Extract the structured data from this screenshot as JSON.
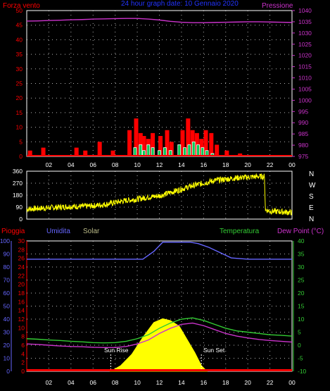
{
  "colors": {
    "background": "#000000",
    "frame": "#ffffff",
    "grid": "#ffffff",
    "wind": "#ff0000",
    "gust": "#ffffff",
    "wind_fill": "#00cc55",
    "pressure": "#cc33cc",
    "direction": "#ffff00",
    "rain": "#ff0000",
    "humidity": "#6666ff",
    "solar": "#ffff00",
    "temperature": "#33cc33",
    "dewpoint": "#cc33cc",
    "title": "#2233ff"
  },
  "header": {
    "left_label": "Forza vento",
    "title": "24 hour graph date: 10 Gennaio 2020",
    "right_label": "Pressione"
  },
  "direction_labels": [
    "N",
    "W",
    "S",
    "E",
    "N"
  ],
  "bottom_labels": {
    "rain": "Pioggia",
    "humidity": "Umidita",
    "solar": "Solar",
    "temperature": "Temperatura",
    "dewpoint": "Dew Point (°C)",
    "sunrise": "Sun Rise",
    "sunset": "Sun Set"
  },
  "chart_data": [
    {
      "type": "bar",
      "name": "wind",
      "ylim": [
        0,
        50
      ],
      "yticks": [
        0,
        5,
        10,
        15,
        20,
        25,
        30,
        35,
        40,
        45,
        50
      ],
      "y2lim": [
        975,
        1040
      ],
      "y2ticks": [
        975,
        980,
        985,
        990,
        995,
        1000,
        1005,
        1010,
        1015,
        1020,
        1025,
        1030,
        1035,
        1040
      ],
      "xlim": [
        0,
        24
      ],
      "xticks": [
        "02",
        "04",
        "06",
        "08",
        "10",
        "12",
        "14",
        "16",
        "18",
        "20",
        "22",
        "00"
      ],
      "series": [
        {
          "role": "wind_gust",
          "x": [
            0.3,
            1.5,
            4.5,
            5.3,
            6.6,
            7.8,
            9.3,
            9.9,
            10.3,
            10.6,
            11.0,
            11.4,
            12.1,
            12.7,
            13.1,
            14.1,
            14.6,
            15.0,
            15.4,
            15.8,
            16.2,
            16.7,
            17.2,
            18.1,
            19.3
          ],
          "values": [
            2,
            3,
            3,
            2,
            5,
            2,
            9,
            13,
            8,
            7,
            6,
            8,
            7,
            9,
            5,
            9,
            13,
            9,
            8,
            6,
            9,
            8,
            4,
            2,
            1
          ]
        },
        {
          "role": "wind_avg",
          "x": [
            9.8,
            10.3,
            10.6,
            11.0,
            11.4,
            12.0,
            12.5,
            13.0,
            13.8,
            14.3,
            14.7,
            15.1,
            15.5,
            15.9,
            16.3,
            16.8
          ],
          "values": [
            3,
            4,
            2,
            4,
            3,
            2,
            3,
            2,
            4,
            3,
            4,
            5,
            4,
            3,
            2,
            1
          ]
        },
        {
          "role": "pressure",
          "x": [
            0,
            1,
            2,
            3,
            4,
            5,
            6,
            7,
            8,
            9,
            10,
            11,
            12,
            13,
            14,
            15,
            16,
            17,
            18,
            19,
            20,
            21,
            22,
            23,
            24
          ],
          "values": [
            1035.3,
            1035.4,
            1035.6,
            1035.7,
            1035.9,
            1036.0,
            1036.2,
            1036.3,
            1036.4,
            1036.5,
            1036.5,
            1036.2,
            1035.8,
            1035.2,
            1034.8,
            1034.6,
            1034.6,
            1034.7,
            1034.8,
            1034.9,
            1035.0,
            1035.0,
            1034.9,
            1034.8,
            1034.7
          ]
        }
      ]
    },
    {
      "type": "line",
      "name": "wind_direction",
      "ylim": [
        0,
        360
      ],
      "yticks": [
        0,
        90,
        180,
        270,
        360
      ],
      "xlim": [
        0,
        24
      ],
      "series": [
        {
          "role": "direction",
          "x": [
            0,
            1,
            2,
            3,
            4,
            5,
            6,
            7,
            8,
            9,
            10,
            11,
            12,
            13,
            14,
            15,
            16,
            17,
            18,
            19,
            20,
            21,
            21.5,
            21.6,
            22,
            23,
            24
          ],
          "values": [
            75,
            80,
            85,
            90,
            95,
            95,
            100,
            110,
            125,
            140,
            150,
            165,
            175,
            200,
            225,
            250,
            270,
            290,
            300,
            310,
            315,
            320,
            320,
            70,
            60,
            55,
            50
          ]
        }
      ]
    },
    {
      "type": "line",
      "name": "atmospheric",
      "ylim": [
        -10,
        40
      ],
      "yticks": [
        -10,
        -5,
        0,
        5,
        10,
        15,
        20,
        25,
        30,
        35,
        40
      ],
      "y_humidity_lim": [
        0,
        100
      ],
      "y_humidity_ticks": [
        0,
        10,
        20,
        30,
        40,
        50,
        60,
        70,
        80,
        90,
        100
      ],
      "y_rain_lim": [
        0,
        30
      ],
      "y_rain_ticks": [
        0,
        2,
        4,
        6,
        8,
        10,
        12,
        14,
        16,
        18,
        20,
        22,
        24,
        26,
        28,
        30
      ],
      "xlim": [
        0,
        24
      ],
      "xticks": [
        "02",
        "04",
        "06",
        "08",
        "10",
        "12",
        "14",
        "16",
        "18",
        "20",
        "22",
        "00"
      ],
      "sunrise_x": 7.6,
      "sunset_x": 15.8,
      "series": [
        {
          "role": "humidity",
          "x": [
            0,
            2,
            4,
            6,
            8,
            9,
            10.5,
            11.5,
            12.3,
            13,
            14,
            14.8,
            15.5,
            16.5,
            17.5,
            18.5,
            20,
            22,
            24
          ],
          "values": [
            86,
            86,
            86,
            86,
            86,
            86,
            86,
            92,
            99,
            99,
            99,
            99,
            98,
            95,
            91,
            87,
            86,
            86,
            86
          ]
        },
        {
          "role": "temperature",
          "x": [
            0,
            1,
            2,
            3,
            4,
            5,
            6,
            7,
            8,
            9,
            10,
            11,
            12,
            13,
            14,
            15,
            16,
            17,
            18,
            19,
            20,
            21,
            22,
            23,
            24
          ],
          "values": [
            2.5,
            2.3,
            2.0,
            1.8,
            1.5,
            1.3,
            1.0,
            0.9,
            1.0,
            1.5,
            2.5,
            4.0,
            6.5,
            8.5,
            10.0,
            10.5,
            9.5,
            8.0,
            6.5,
            5.5,
            5.0,
            4.5,
            4.0,
            3.8,
            3.5
          ]
        },
        {
          "role": "dewpoint",
          "x": [
            0,
            1,
            2,
            3,
            4,
            5,
            6,
            7,
            8,
            9,
            10,
            11,
            12,
            13,
            14,
            15,
            16,
            17,
            18,
            19,
            20,
            21,
            22,
            23,
            24
          ],
          "values": [
            0.5,
            0.3,
            0,
            -0.3,
            -0.5,
            -0.6,
            -0.8,
            -0.9,
            -0.9,
            -0.5,
            0.5,
            2.0,
            4.5,
            6.5,
            8.0,
            8.5,
            7.5,
            6.0,
            4.5,
            3.5,
            2.8,
            2.2,
            1.8,
            1.5,
            1.2
          ]
        },
        {
          "role": "solar",
          "x": [
            7.6,
            8.5,
            9.5,
            10.5,
            11.5,
            12.3,
            13.0,
            13.8,
            14.5,
            15.2,
            15.8,
            16.3
          ],
          "values": [
            0,
            3,
            9,
            18,
            26,
            28,
            27,
            24,
            17,
            10,
            3,
            0
          ]
        },
        {
          "role": "rain",
          "x": [
            0,
            24
          ],
          "values": [
            0,
            0
          ]
        }
      ]
    }
  ]
}
